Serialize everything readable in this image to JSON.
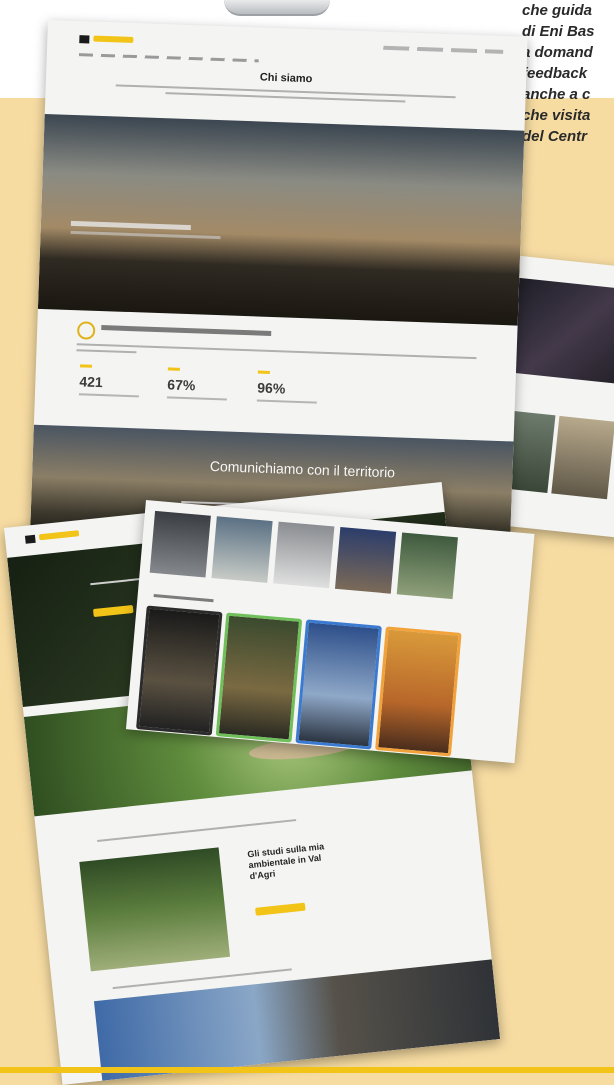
{
  "side_text": {
    "lines": [
      "che guida",
      "di Eni Bas",
      "a domand",
      "feedback",
      "anche a c",
      "che visita",
      "del Centr"
    ]
  },
  "sheet_about": {
    "page_title": "Chi siamo",
    "stats": [
      "421",
      "67%",
      "96%"
    ],
    "cta_title": "Comunichiamo con il territorio"
  },
  "sheet_home": {
    "section_heading": "Gli studi sulla mia ambientale in Val d'Agri"
  },
  "colors": {
    "background": "#f7dca2",
    "accent_yellow": "#f2c418",
    "page": "#f4f4f2"
  }
}
